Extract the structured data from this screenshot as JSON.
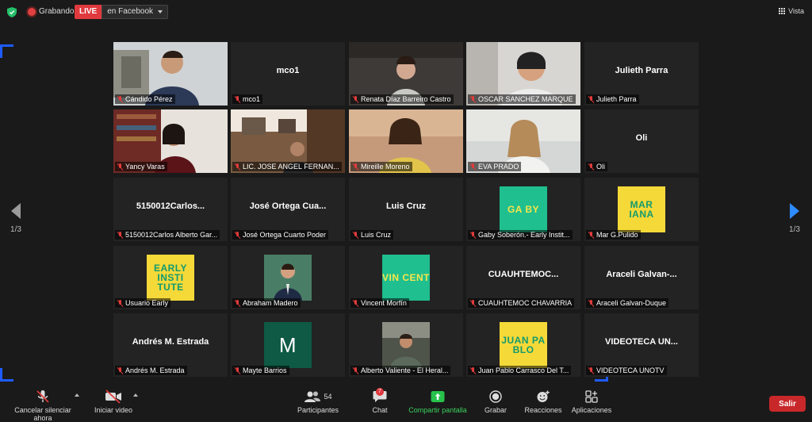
{
  "topbar": {
    "recording_label": "Grabando",
    "live_label": "LIVE",
    "live_destination": "en Facebook",
    "view_label": "Vista"
  },
  "pagination": {
    "left": "1/3",
    "right": "1/3"
  },
  "colors": {
    "live": "#e0393e",
    "active_speaker": "#b9e24a",
    "accent_blue": "#2d8cff",
    "share_green": "#3bd25e",
    "leave_red": "#c8282a"
  },
  "tiles": [
    {
      "label": "Cándido Pérez",
      "type": "video",
      "col": 0,
      "row": 0
    },
    {
      "label": "mco1",
      "center": "mco1",
      "type": "name",
      "col": 1,
      "row": 0
    },
    {
      "label": "Renata Díaz Barreiro Castro",
      "type": "video",
      "col": 2,
      "row": 0
    },
    {
      "label": "OSCAR SANCHEZ MARQUE",
      "type": "video",
      "col": 3,
      "row": 0
    },
    {
      "label": "Julieth Parra",
      "center": "Julieth Parra",
      "type": "name",
      "col": 4,
      "row": 0
    },
    {
      "label": "Yancy Varas",
      "type": "video",
      "col": 0,
      "row": 1
    },
    {
      "label": "LIC. JOSE ANGEL FERNAN...",
      "type": "video",
      "col": 1,
      "row": 1
    },
    {
      "label": "Mireille Moreno",
      "type": "video",
      "col": 2,
      "row": 1
    },
    {
      "label": "EVA PRADO",
      "type": "video",
      "active": true,
      "col": 3,
      "row": 1
    },
    {
      "label": "Oli",
      "center": "Oli",
      "type": "name",
      "col": 4,
      "row": 1
    },
    {
      "label": "5150012Carlos Alberto Gar...",
      "center": "5150012Carlos...",
      "type": "name",
      "col": 0,
      "row": 2
    },
    {
      "label": "José Ortega Cuarto Poder",
      "center": "José Ortega Cua...",
      "type": "name",
      "col": 1,
      "row": 2
    },
    {
      "label": "Luis Cruz",
      "center": "Luis Cruz",
      "type": "name",
      "col": 2,
      "row": 2
    },
    {
      "label": "Gaby Soberón.- Early Instit...",
      "avatar": "GA BY",
      "avatar_bg": "#1fbf8f",
      "avatar_fg": "#f7e64a",
      "type": "avatar",
      "col": 3,
      "row": 2
    },
    {
      "label": "Mar G.Pulido",
      "avatar": "MAR IANA",
      "avatar_bg": "#f5d938",
      "avatar_fg": "#139a6e",
      "type": "avatar",
      "col": 4,
      "row": 2
    },
    {
      "label": "Usuario Early",
      "avatar": "EARLY INSTI TUTE",
      "avatar_bg": "#f5d938",
      "avatar_fg": "#139a6e",
      "type": "avatar",
      "col": 0,
      "row": 3
    },
    {
      "label": "Abraham Madero",
      "type": "photo",
      "col": 1,
      "row": 3
    },
    {
      "label": "Vincent Morfín",
      "avatar": "VIN CENT",
      "avatar_bg": "#1fbf8f",
      "avatar_fg": "#f7e64a",
      "type": "avatar",
      "col": 2,
      "row": 3
    },
    {
      "label": "CUAUHTEMOC CHAVARRIA",
      "center": "CUAUHTEMOC...",
      "type": "name",
      "col": 3,
      "row": 3
    },
    {
      "label": "Araceli Galvan-Duque",
      "center": "Araceli Galvan-...",
      "type": "name",
      "col": 4,
      "row": 3
    },
    {
      "label": "Andrés M. Estrada",
      "center": "Andrés M. Estrada",
      "type": "name",
      "col": 0,
      "row": 4
    },
    {
      "label": "Mayte Barrios",
      "avatar": "M",
      "avatar_bg": "#0e5a44",
      "avatar_fg": "#ffffff",
      "type": "avatar",
      "col": 1,
      "row": 4
    },
    {
      "label": "Alberto Valiente - El Heral...",
      "type": "photo",
      "col": 2,
      "row": 4
    },
    {
      "label": "Juan Pablo Carrasco Del T...",
      "avatar": "JUAN PA BLO",
      "avatar_bg": "#f5d938",
      "avatar_fg": "#139a6e",
      "type": "avatar",
      "col": 3,
      "row": 4
    },
    {
      "label": "VIDEOTECA UNOTV",
      "center": "VIDEOTECA UN...",
      "type": "name",
      "col": 4,
      "row": 4
    }
  ],
  "toolbar": {
    "mute_label": "Cancelar silenciar ahora",
    "video_label": "Iniciar video",
    "participants_label": "Participantes",
    "participants_count": "54",
    "chat_label": "Chat",
    "chat_badge": "7",
    "share_label": "Compartir pantalla",
    "record_label": "Grabar",
    "reactions_label": "Reacciones",
    "apps_label": "Aplicaciones",
    "leave_label": "Salir"
  }
}
